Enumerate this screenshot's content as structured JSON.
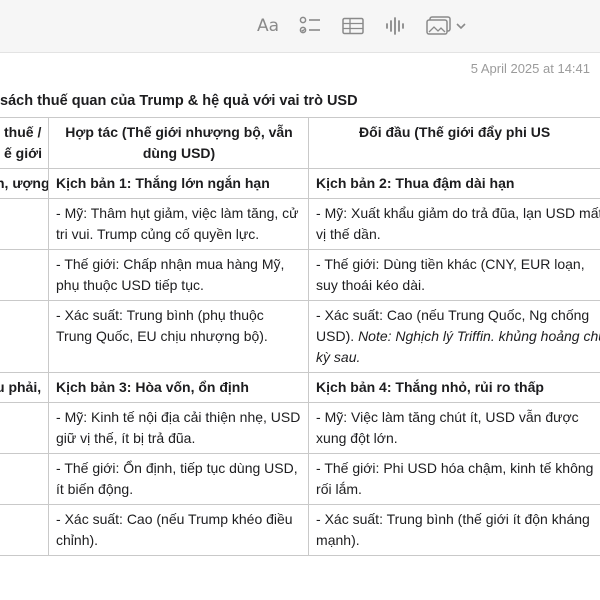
{
  "toolbar": {
    "format_label": "Aa",
    "format_icon": "text-format-icon",
    "checklist_icon": "checklist-icon",
    "table_icon": "table-icon",
    "audio_icon": "audio-waveform-icon",
    "media_icon": "photo-media-icon"
  },
  "note": {
    "timestamp": "5 April 2025 at 14:41",
    "title": "sách thuế quan của Trump & hệ quả với vai trò USD"
  },
  "table": {
    "headers": [
      "thuế / ế giới",
      "Hợp tác (Thế giới nhượng bộ, vẫn dùng USD)",
      "Đối đầu (Thế giới đẩy phi US"
    ],
    "rows": [
      [
        "h, ượng)",
        "Kịch bản 1: Thắng lớn ngắn hạn",
        "Kịch bản 2: Thua đậm dài hạn"
      ],
      [
        "",
        "- Mỹ: Thâm hụt giảm, việc làm tăng, cử tri vui. Trump củng cố quyền lực.",
        "- Mỹ: Xuất khẩu giảm do trả đũa, lạn USD mất vị thế dần."
      ],
      [
        "",
        "- Thế giới: Chấp nhận mua hàng Mỹ, phụ thuộc USD tiếp tục.",
        "- Thế giới: Dùng tiền khác (CNY, EUR loạn, suy thoái kéo dài."
      ],
      [
        "",
        "- Xác suất: Trung bình (phụ thuộc Trung Quốc, EU chịu nhượng bộ).",
        "- Xác suất: Cao (nếu Trung Quốc, Ng chống USD)."
      ],
      [
        "u phải,",
        "Kịch bản 3: Hòa vốn, ổn định",
        "Kịch bản 4: Thắng nhỏ, rủi ro thấp"
      ],
      [
        "",
        "- Mỹ: Kinh tế nội địa cải thiện nhẹ, USD giữ vị thế, ít bị trả đũa.",
        "- Mỹ: Việc làm tăng chút ít, USD vẫn được xung đột lớn."
      ],
      [
        "",
        "- Thế giới: Ổn định, tiếp tục dùng USD, ít biến động.",
        "- Thế giới: Phi USD hóa chậm, kinh tế không rối lắm."
      ],
      [
        "",
        "- Xác suất: Cao (nếu Trump khéo điều chỉnh).",
        "- Xác suất: Trung bình (thế giới ít độn kháng mạnh)."
      ]
    ],
    "row4_note": "Note: Nghịch lý Triffin. khủng hoảng chu kỳ sau."
  }
}
